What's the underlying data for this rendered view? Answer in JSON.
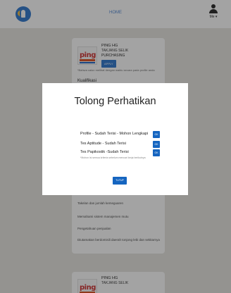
{
  "header": {
    "home_link": "HOME",
    "user_label": "Me ▾"
  },
  "job_card": {
    "company": "PING HG",
    "location": "TAKJANG SELIK",
    "department": "PURCHASING",
    "apply_label": "APPLY",
    "notice": "*Bahwa calon melihat dengan waktu secara pada profile anda",
    "kualifikasi_title": "Kualifikasi",
    "requirements": [
      "Takelan dan jumlah kemeguaren",
      "Memahami sistem manajemen mutu",
      "Pengetahuan penjualan",
      "Diutamakan berdomisili daerah tonjong lebi dan sekitarnya"
    ]
  },
  "job_card_2": {
    "company": "PING HG",
    "location": "TAKJANG SELIK"
  },
  "modal": {
    "title": "Tolong Perhatikan",
    "statuses": [
      {
        "text": "Profile - Sudah Terisi - Mohon Lengkapi",
        "button": "OK"
      },
      {
        "text": "Tes Aptitude - Sudah Terisi",
        "button": "OK"
      },
      {
        "text": "Tes Papikostik -Sudah Terisi",
        "button": "OK"
      }
    ],
    "note": "*Mohon isi semua kriteria sebelum mencari kerja berikutnya",
    "close_label": "TUTUP"
  }
}
